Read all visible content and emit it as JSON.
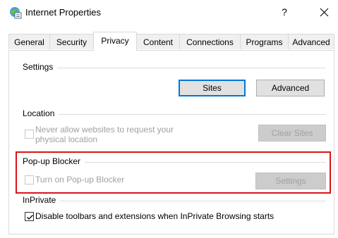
{
  "window": {
    "title": "Internet Properties",
    "help_label": "?",
    "icon": "internet-globe-icon"
  },
  "tabs": [
    {
      "label": "General"
    },
    {
      "label": "Security"
    },
    {
      "label": "Privacy",
      "active": true
    },
    {
      "label": "Content"
    },
    {
      "label": "Connections"
    },
    {
      "label": "Programs"
    },
    {
      "label": "Advanced"
    }
  ],
  "settings": {
    "heading": "Settings",
    "sites_label": "Sites",
    "advanced_label": "Advanced"
  },
  "location": {
    "heading": "Location",
    "checkbox_line1": "Never allow websites to request your",
    "checkbox_line2": "physical location",
    "checked": false,
    "enabled": false,
    "clear_sites_label": "Clear Sites"
  },
  "popup_blocker": {
    "heading": "Pop-up Blocker",
    "checkbox_label": "Turn on Pop-up Blocker",
    "checked": false,
    "enabled": false,
    "settings_label": "Settings",
    "highlight_color": "#d9141b"
  },
  "inprivate": {
    "heading": "InPrivate",
    "checkbox_label": "Disable toolbars and extensions when InPrivate Browsing starts",
    "checked": true
  },
  "colors": {
    "focus_border": "#0078d7",
    "disabled_text": "#a0a0a0"
  }
}
